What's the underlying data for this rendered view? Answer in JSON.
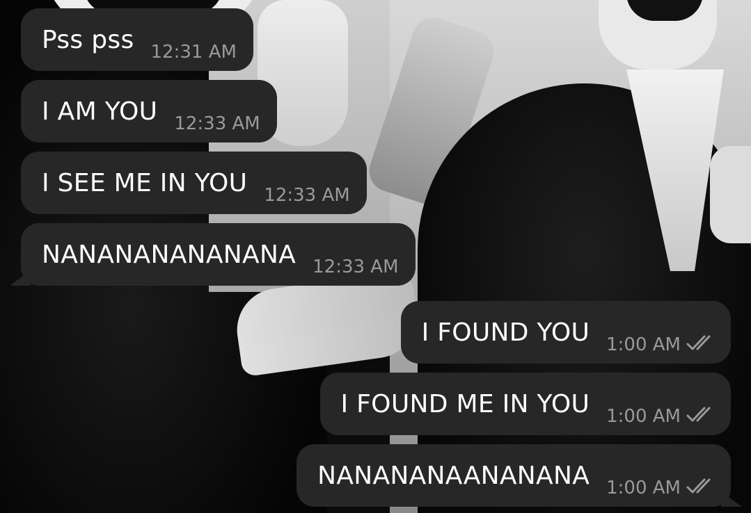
{
  "messages": [
    {
      "direction": "incoming",
      "text": "Pss pss",
      "time": "12:31 AM"
    },
    {
      "direction": "incoming",
      "text": "I AM YOU",
      "time": "12:33 AM"
    },
    {
      "direction": "incoming",
      "text": "I SEE ME IN YOU",
      "time": "12:33 AM"
    },
    {
      "direction": "incoming",
      "text": "NANANANANANANA",
      "time": "12:33 AM"
    },
    {
      "direction": "outgoing",
      "text": "I FOUND YOU",
      "time": "1:00 AM",
      "status_icon": "double-check-read-icon"
    },
    {
      "direction": "outgoing",
      "text": "I FOUND ME IN YOU",
      "time": "1:00 AM",
      "status_icon": "double-check-read-icon"
    },
    {
      "direction": "outgoing",
      "text": "NANANANAANANANA",
      "time": "1:00 AM",
      "status_icon": "double-check-read-icon"
    }
  ],
  "colors": {
    "bubble": "#272727",
    "text": "#ffffff",
    "time": "#9a9a9a"
  }
}
